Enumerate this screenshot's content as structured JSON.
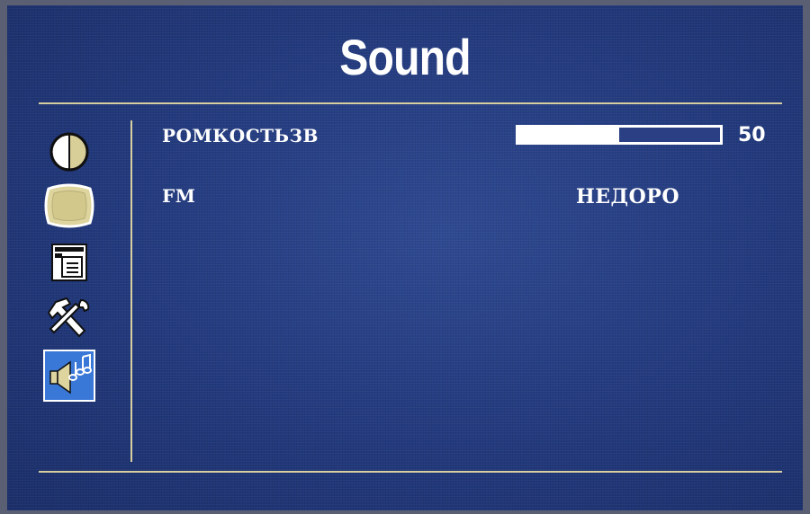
{
  "menu": {
    "title": "Sound",
    "sidebar_icons": [
      {
        "name": "contrast-icon",
        "selected": false
      },
      {
        "name": "picture-icon",
        "selected": false
      },
      {
        "name": "settings-menu-icon",
        "selected": false
      },
      {
        "name": "tools-icon",
        "selected": false
      },
      {
        "name": "sound-icon",
        "selected": true
      }
    ],
    "items": [
      {
        "label": "РОМКОСТЬЗВ",
        "value": "50",
        "level_percent": 50
      },
      {
        "label": "FM",
        "value": "НЕДОРО"
      }
    ]
  },
  "colors": {
    "background": "#22397c",
    "rule": "#d8cfa0",
    "text": "#ffffff",
    "selected_icon_bg": "#3a78d8"
  }
}
